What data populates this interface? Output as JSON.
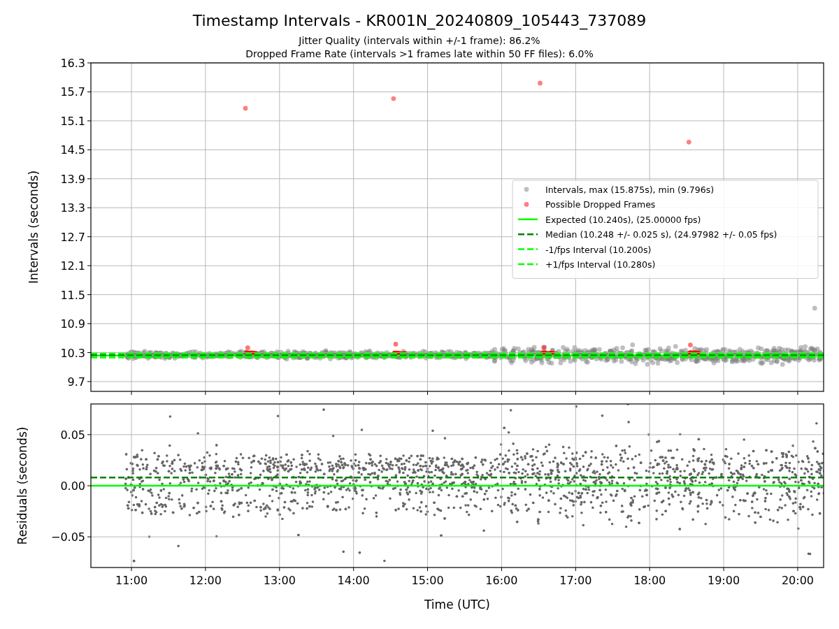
{
  "figure": {
    "title": "Timestamp Intervals - KR001N_20240809_105443_737089",
    "subtitles": [
      "Jitter Quality (intervals within +/-1 frame): 86.2%",
      "Dropped Frame Rate (intervals >1 frames late within 50 FF files): 6.0%"
    ]
  },
  "panels": [
    {
      "chart_data": {
        "type": "scatter",
        "ylabel": "Intervals (seconds)",
        "xlim": [
          10.452,
          20.35
        ],
        "ylim": [
          9.497,
          16.3
        ],
        "grid": true,
        "yticks": [
          {
            "value": 9.7,
            "label": "9.7"
          },
          {
            "value": 10.3,
            "label": "10.3"
          },
          {
            "value": 10.9,
            "label": "10.9"
          },
          {
            "value": 11.5,
            "label": "11.5"
          },
          {
            "value": 12.1,
            "label": "12.1"
          },
          {
            "value": 12.7,
            "label": "12.7"
          },
          {
            "value": 13.3,
            "label": "13.3"
          },
          {
            "value": 13.9,
            "label": "13.9"
          },
          {
            "value": 14.5,
            "label": "14.5"
          },
          {
            "value": 15.1,
            "label": "15.1"
          },
          {
            "value": 15.7,
            "label": "15.7"
          },
          {
            "value": 16.3,
            "label": "16.3"
          }
        ],
        "series": [
          {
            "name": "Intervals, max (15.875s), min (9.796s)",
            "color": "#808080",
            "x": [
              20.23
            ],
            "values": [
              11.22
            ]
          },
          {
            "name": "Possible Dropped Frames",
            "color": "#ff0000",
            "x": [
              12.54,
              14.54,
              16.52,
              18.53
            ],
            "values": [
              15.36,
              15.56,
              15.88,
              14.66
            ]
          }
        ],
        "legend": true,
        "ref_lines": [
          {
            "axis": "y",
            "value": 10.24,
            "label": "Expected (10.240s), (25.00000 fps)",
            "color": "#00ff00",
            "line_style": "solid"
          },
          {
            "axis": "y",
            "value": 10.248,
            "label": "Median (10.248 +/- 0.025 s), (24.97982 +/- 0.05 fps)",
            "color": "#008000",
            "line_style": "dashed"
          },
          {
            "axis": "y",
            "value": 10.2,
            "label": "-1/fps Interval (10.200s)",
            "color": "#00ff00",
            "line_style": "dashed"
          },
          {
            "axis": "y",
            "value": 10.28,
            "label": "+1/fps Interval (10.280s)",
            "color": "#00ff00",
            "line_style": "dashed"
          }
        ]
      }
    },
    {
      "chart_data": {
        "type": "scatter",
        "xlabel": "Time (UTC)",
        "ylabel": "Residuals (seconds)",
        "xlim": [
          10.452,
          20.35
        ],
        "ylim": [
          -0.08,
          0.08
        ],
        "grid": true,
        "xticks": [
          {
            "value": 11,
            "label": "11:00"
          },
          {
            "value": 12,
            "label": "12:00"
          },
          {
            "value": 13,
            "label": "13:00"
          },
          {
            "value": 14,
            "label": "14:00"
          },
          {
            "value": 15,
            "label": "15:00"
          },
          {
            "value": 16,
            "label": "16:00"
          },
          {
            "value": 17,
            "label": "17:00"
          },
          {
            "value": 18,
            "label": "18:00"
          },
          {
            "value": 19,
            "label": "19:00"
          },
          {
            "value": 20,
            "label": "20:00"
          }
        ],
        "yticks": [
          {
            "value": -0.05,
            "label": "−0.05"
          },
          {
            "value": 0,
            "label": "0.00"
          },
          {
            "value": 0.05,
            "label": "0.05"
          }
        ],
        "ref_lines": [
          {
            "axis": "y",
            "value": 0,
            "color": "#00ff00",
            "line_style": "solid"
          },
          {
            "axis": "y",
            "value": 0.008,
            "color": "#008000",
            "line_style": "dashed"
          }
        ]
      }
    }
  ]
}
